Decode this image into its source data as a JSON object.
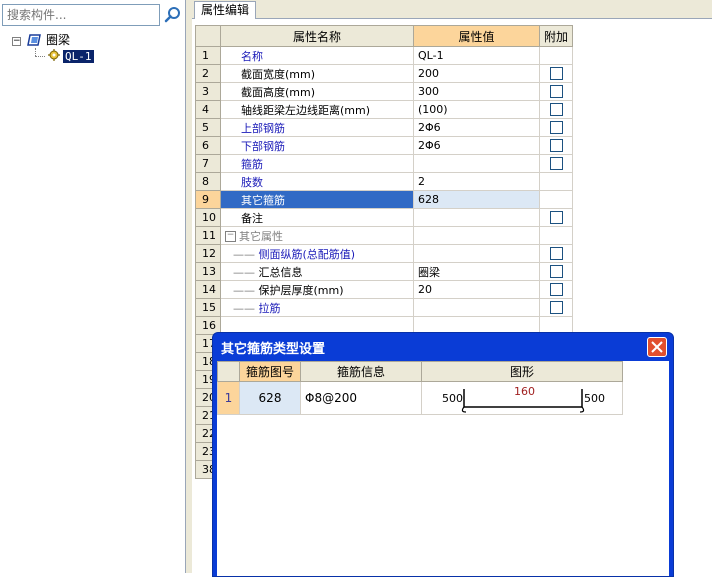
{
  "search": {
    "placeholder": "搜索构件..."
  },
  "tree": {
    "root_label": "圈梁",
    "child_label": "QL-1"
  },
  "tab": {
    "label": "属性编辑"
  },
  "grid": {
    "headers": {
      "name": "属性名称",
      "value": "属性值",
      "extra": "附加"
    },
    "rows": [
      {
        "num": "1",
        "name": "名称",
        "value": "QL-1"
      },
      {
        "num": "2",
        "name": "截面宽度(mm)",
        "value": "200"
      },
      {
        "num": "3",
        "name": "截面高度(mm)",
        "value": "300"
      },
      {
        "num": "4",
        "name": "轴线距梁左边线距离(mm)",
        "value": "(100)"
      },
      {
        "num": "5",
        "name": "上部钢筋",
        "value": "2Φ6"
      },
      {
        "num": "6",
        "name": "下部钢筋",
        "value": "2Φ6"
      },
      {
        "num": "7",
        "name": "箍筋",
        "value": ""
      },
      {
        "num": "8",
        "name": "肢数",
        "value": "2"
      },
      {
        "num": "9",
        "name": "其它箍筋",
        "value": "628"
      },
      {
        "num": "10",
        "name": "备注",
        "value": ""
      },
      {
        "num": "11",
        "name": "其它属性",
        "value": ""
      },
      {
        "num": "12",
        "name": "侧面纵筋(总配筋值)",
        "value": ""
      },
      {
        "num": "13",
        "name": "汇总信息",
        "value": "圈梁"
      },
      {
        "num": "14",
        "name": "保护层厚度(mm)",
        "value": "20"
      },
      {
        "num": "15",
        "name": "拉筋",
        "value": ""
      },
      {
        "num": "16",
        "name": "",
        "value": ""
      },
      {
        "num": "17",
        "name": "",
        "value": ""
      },
      {
        "num": "18",
        "name": "",
        "value": ""
      },
      {
        "num": "19",
        "name": "",
        "value": ""
      },
      {
        "num": "20",
        "name": "",
        "value": ""
      },
      {
        "num": "21",
        "name": "",
        "value": ""
      },
      {
        "num": "22",
        "name": "",
        "value": ""
      },
      {
        "num": "23",
        "name": "",
        "value": ""
      },
      {
        "num": "38",
        "name": "",
        "value": ""
      }
    ]
  },
  "dialog": {
    "title": "其它箍筋类型设置",
    "headers": {
      "code": "箍筋图号",
      "info": "箍筋信息",
      "shape": "图形"
    },
    "row": {
      "num": "1",
      "code": "628",
      "info": "Φ8@200",
      "left": "500",
      "middle": "160",
      "right": "500"
    }
  },
  "colors": {
    "selection": "#316ac5",
    "header_active": "#fcd59b",
    "dialog_title": "#0a3cd6",
    "blue_label": "#1a1ab8"
  }
}
